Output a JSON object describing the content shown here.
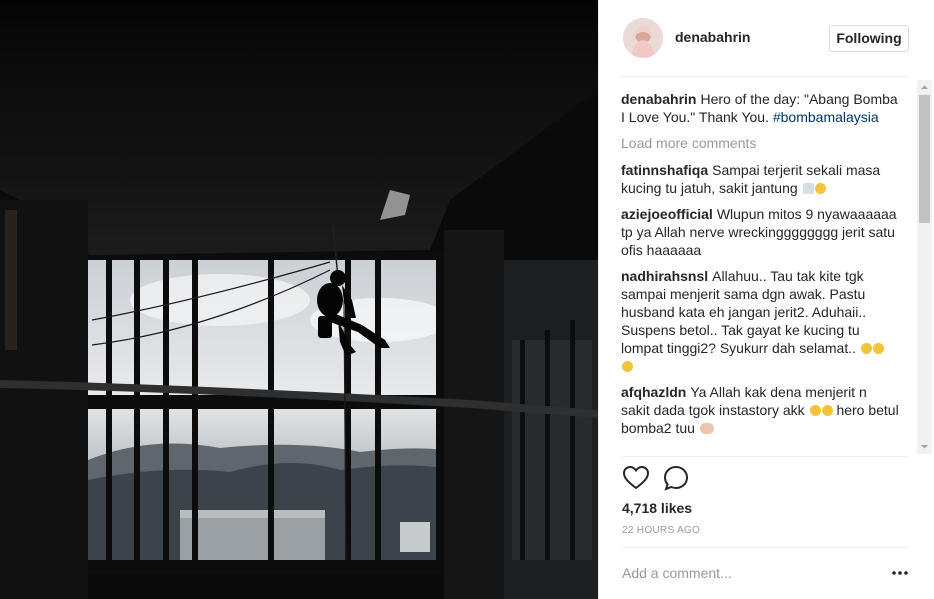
{
  "post": {
    "username": "denabahrin",
    "follow_label": "Following",
    "caption_user": "denabahrin",
    "caption_text": "Hero of the day: \"Abang Bomba I Love You.\" Thank You.",
    "caption_hashtag": "#bombamalaysia",
    "load_more_label": "Load more comments",
    "likes": "4,718 likes",
    "time": "22 HOURS AGO",
    "add_comment_placeholder": "Add a comment..."
  },
  "comments": [
    {
      "user": "fatinnshafiqa",
      "text": "Sampai terjerit sekali masa kucing tu jatuh, sakit jantung",
      "emoji": [
        "scream-cat",
        "grimace-face"
      ]
    },
    {
      "user": "aziejoeofficial",
      "text": "Wlupun mitos 9 nyawaaaaaa tp ya Allah nerve wreckingggggggg jerit satu ofis haaaaaa",
      "emoji": []
    },
    {
      "user": "nadhirahsnsl",
      "text": "Allahuu.. Tau tak kite tgk sampai menjerit sama dgn awak. Pastu husband kata eh jangan jerit2. Aduhaii.. Suspens betol.. Tak gayat ke kucing tu lompat tinggi2? Syukurr dah selamat..",
      "emoji": [
        "relieved-face",
        "relieved-face",
        "relieved-face"
      ]
    },
    {
      "user": "afqhazldn",
      "text": "Ya Allah kak dena menjerit n sakit dada tgok instastory akk",
      "text2": "hero betul bomba2 tuu",
      "emoji": [
        "grimace-face",
        "astonished-face"
      ],
      "emoji2": [
        "flexed-arm"
      ]
    }
  ],
  "icons": {
    "like": "heart-icon",
    "comment": "comment-bubble-icon",
    "more": "more-options-icon"
  },
  "colors": {
    "hashtag": "#003569",
    "follow_border": "#dbdbdb",
    "muted": "#999999"
  }
}
